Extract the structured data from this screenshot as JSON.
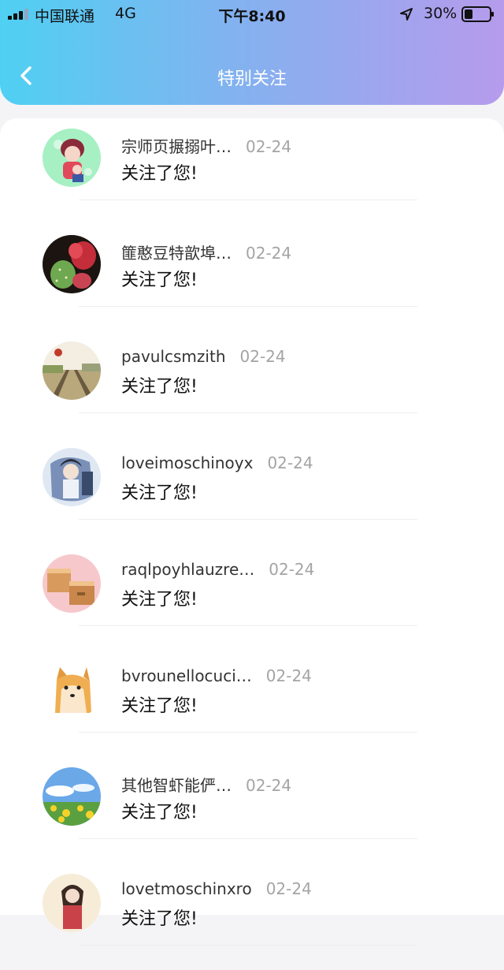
{
  "status_bar": {
    "carrier": "中国联通",
    "network": "4G",
    "time": "下午8:40",
    "battery_percent": "30%"
  },
  "header": {
    "title": "特别关注"
  },
  "items": [
    {
      "name": "宗师页搌搦叶…",
      "date": "02-24",
      "message": "关注了您!",
      "avatar": "cartoon-boy-avatar"
    },
    {
      "name": "篚憨豆特歆埠…",
      "date": "02-24",
      "message": "关注了您!",
      "avatar": "cactus-flower-avatar"
    },
    {
      "name": "pavulcsmzith",
      "date": "02-24",
      "message": "关注了您!",
      "avatar": "railway-track-avatar"
    },
    {
      "name": "loveimoschinoyx",
      "date": "02-24",
      "message": "关注了您!",
      "avatar": "anime-warrior-avatar"
    },
    {
      "name": "raqlpoyhlauzre…",
      "date": "02-24",
      "message": "关注了您!",
      "avatar": "wooden-boxes-avatar"
    },
    {
      "name": "bvrounellocuci…",
      "date": "02-24",
      "message": "关注了您!",
      "avatar": "shiba-dog-avatar"
    },
    {
      "name": "其他智虾能俨…",
      "date": "02-24",
      "message": "关注了您!",
      "avatar": "sky-flowers-avatar"
    },
    {
      "name": "lovetmoschinxro",
      "date": "02-24",
      "message": "关注了您!",
      "avatar": "costume-girl-avatar"
    }
  ]
}
